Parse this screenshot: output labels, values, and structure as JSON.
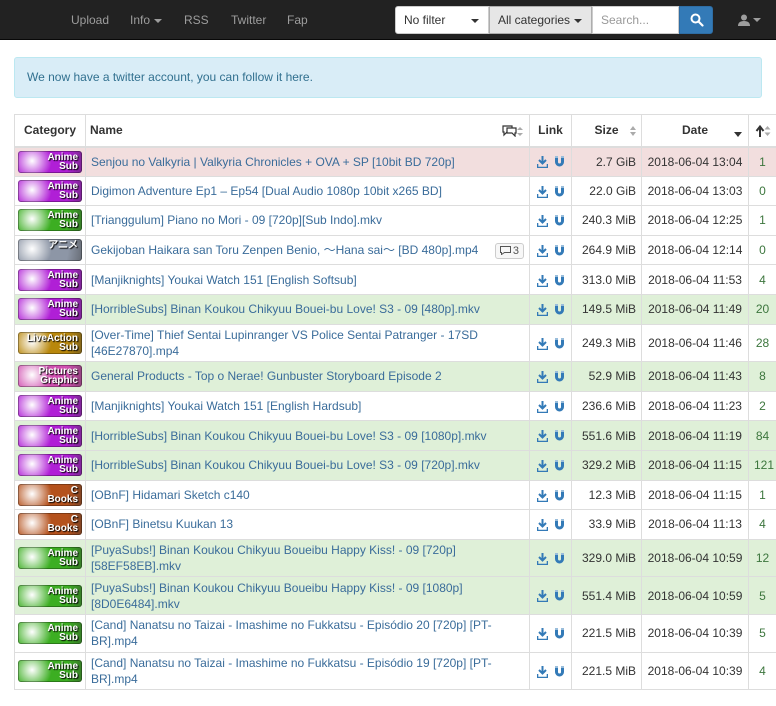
{
  "nav": {
    "links": [
      "Upload",
      "Info",
      "RSS",
      "Twitter",
      "Fap"
    ]
  },
  "search": {
    "filter": "No filter",
    "category": "All categories",
    "placeholder": "Search..."
  },
  "alert": {
    "text": "We now have a twitter account, you can follow it here."
  },
  "table": {
    "headers": {
      "category": "Category",
      "name": "Name",
      "link": "Link",
      "size": "Size",
      "date": "Date"
    },
    "rows": [
      {
        "cat": [
          "Anime",
          "Sub"
        ],
        "catColor": "#b01fd6",
        "name": "Senjou no Valkyria | Valkyria Chronicles + OVA + SP [10bit BD 720p]",
        "size": "2.7 GiB",
        "date": "2018-06-04 13:04",
        "seeders": "1",
        "status": "danger",
        "tall": false
      },
      {
        "cat": [
          "Anime",
          "Sub"
        ],
        "catColor": "#b01fd6",
        "name": "Digimon Adventure Ep1 – Ep54 [Dual Audio 1080p 10bit x265 BD]",
        "size": "22.0 GiB",
        "date": "2018-06-04 13:03",
        "seeders": "0",
        "status": "default",
        "tall": false
      },
      {
        "cat": [
          "Anime",
          "Sub"
        ],
        "catColor": "#3cae22",
        "name": "[Trianggulum] Piano no Mori - 09 [720p][Sub Indo].mkv",
        "size": "240.3 MiB",
        "date": "2018-06-04 12:25",
        "seeders": "1",
        "status": "default",
        "tall": false
      },
      {
        "cat": [
          "アニメ",
          ""
        ],
        "catColor": "#8d96a6",
        "name": "Gekijoban Haikara san Toru Zenpen Benio, 〜Hana sai〜 [BD 480p].mp4",
        "comments": "3",
        "size": "264.9 MiB",
        "date": "2018-06-04 12:14",
        "seeders": "0",
        "status": "default",
        "tall": false
      },
      {
        "cat": [
          "Anime",
          "Sub"
        ],
        "catColor": "#b01fd6",
        "name": "[Manjiknights] Youkai Watch 151 [English Softsub]",
        "size": "313.0 MiB",
        "date": "2018-06-04 11:53",
        "seeders": "4",
        "status": "default",
        "tall": false
      },
      {
        "cat": [
          "Anime",
          "Sub"
        ],
        "catColor": "#b01fd6",
        "name": "[HorribleSubs] Binan Koukou Chikyuu Bouei-bu Love! S3 - 09 [480p].mkv",
        "size": "149.5 MiB",
        "date": "2018-06-04 11:49",
        "seeders": "20",
        "status": "success",
        "tall": false
      },
      {
        "cat": [
          "LiveAction",
          "Sub"
        ],
        "catColor": "#b8870c",
        "name": "[Over-Time] Thief Sentai Lupinranger VS Police Sentai Patranger - 17SD [46E27870].mp4",
        "size": "249.3 MiB",
        "date": "2018-06-04 11:46",
        "seeders": "28",
        "status": "default",
        "tall": true
      },
      {
        "cat": [
          "Pictures",
          "Graphic"
        ],
        "catColor": "#d04fb0",
        "name": "General Products - Top o Nerae! Gunbuster Storyboard Episode 2",
        "size": "52.9 MiB",
        "date": "2018-06-04 11:43",
        "seeders": "8",
        "status": "success",
        "tall": false
      },
      {
        "cat": [
          "Anime",
          "Sub"
        ],
        "catColor": "#b01fd6",
        "name": "[Manjiknights] Youkai Watch 151 [English Hardsub]",
        "size": "236.6 MiB",
        "date": "2018-06-04 11:23",
        "seeders": "2",
        "status": "default",
        "tall": false
      },
      {
        "cat": [
          "Anime",
          "Sub"
        ],
        "catColor": "#b01fd6",
        "name": "[HorribleSubs] Binan Koukou Chikyuu Bouei-bu Love! S3 - 09 [1080p].mkv",
        "size": "551.6 MiB",
        "date": "2018-06-04 11:19",
        "seeders": "84",
        "status": "success",
        "tall": false
      },
      {
        "cat": [
          "Anime",
          "Sub"
        ],
        "catColor": "#b01fd6",
        "name": "[HorribleSubs] Binan Koukou Chikyuu Bouei-bu Love! S3 - 09 [720p].mkv",
        "size": "329.2 MiB",
        "date": "2018-06-04 11:15",
        "seeders": "121",
        "status": "success",
        "tall": false
      },
      {
        "cat": [
          "C",
          "Books"
        ],
        "catColor": "#b4511c",
        "name": "[OBnF] Hidamari Sketch c140",
        "size": "12.3 MiB",
        "date": "2018-06-04 11:15",
        "seeders": "1",
        "status": "default",
        "tall": false
      },
      {
        "cat": [
          "C",
          "Books"
        ],
        "catColor": "#b4511c",
        "name": "[OBnF] Binetsu Kuukan 13",
        "size": "33.9 MiB",
        "date": "2018-06-04 11:13",
        "seeders": "4",
        "status": "default",
        "tall": false
      },
      {
        "cat": [
          "Anime",
          "Sub"
        ],
        "catColor": "#3cae22",
        "name": "[PuyaSubs!] Binan Koukou Chikyuu Boueibu Happy Kiss! - 09 [720p] [58EF58EB].mkv",
        "size": "329.0 MiB",
        "date": "2018-06-04 10:59",
        "seeders": "12",
        "status": "success",
        "tall": true
      },
      {
        "cat": [
          "Anime",
          "Sub"
        ],
        "catColor": "#3cae22",
        "name": "[PuyaSubs!] Binan Koukou Chikyuu Boueibu Happy Kiss! - 09 [1080p] [8D0E6484].mkv",
        "size": "551.4 MiB",
        "date": "2018-06-04 10:59",
        "seeders": "5",
        "status": "success",
        "tall": true
      },
      {
        "cat": [
          "Anime",
          "Sub"
        ],
        "catColor": "#3cae22",
        "name": "[Cand] Nanatsu no Taizai - Imashime no Fukkatsu - Episódio 20 [720p] [PT-BR].mp4",
        "size": "221.5 MiB",
        "date": "2018-06-04 10:39",
        "seeders": "5",
        "status": "default",
        "tall": true
      },
      {
        "cat": [
          "Anime",
          "Sub"
        ],
        "catColor": "#3cae22",
        "name": "[Cand] Nanatsu no Taizai - Imashime no Fukkatsu - Episódio 19 [720p] [PT-BR].mp4",
        "size": "221.5 MiB",
        "date": "2018-06-04 10:39",
        "seeders": "4",
        "status": "default",
        "tall": true
      }
    ]
  },
  "colors": {
    "navbar": "#222222",
    "link": "#3a6c9a",
    "danger_row": "#f2dede",
    "success_row": "#dff0d8",
    "primary": "#337ab7"
  }
}
